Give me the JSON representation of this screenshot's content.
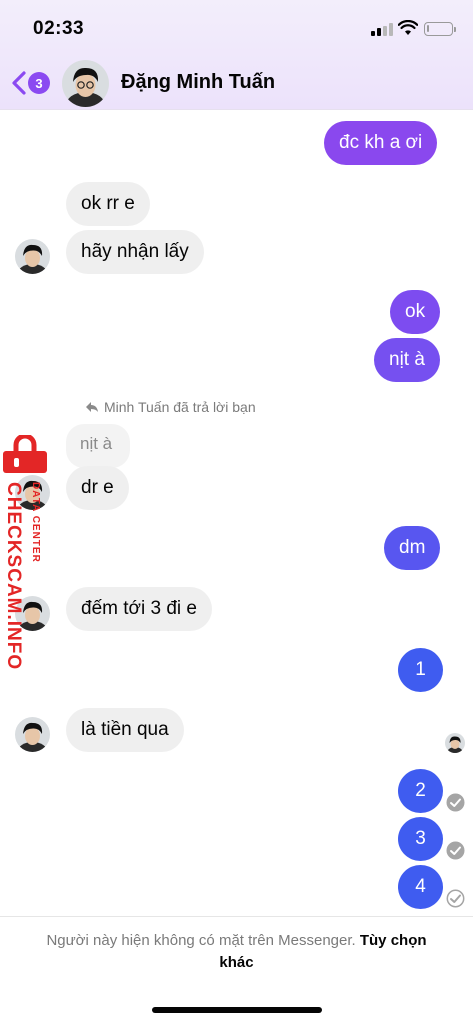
{
  "status_bar": {
    "time": "02:33"
  },
  "header": {
    "back_badge": "3",
    "contact_name": "Đặng Minh Tuấn",
    "icons": [
      "chevron-left-icon",
      "avatar"
    ]
  },
  "colors": {
    "accent": "#8b4af1",
    "out_purple": "#7a4ef0",
    "out_blue": "#3f5cf0",
    "in_bubble": "#efefef"
  },
  "messages": [
    {
      "id": "m1",
      "side": "out",
      "text": "đc kh a ơi"
    },
    {
      "id": "m2",
      "side": "in",
      "text": "ok rr e"
    },
    {
      "id": "m3",
      "side": "in",
      "text": "hãy nhận lấy"
    },
    {
      "id": "m4",
      "side": "out",
      "text": "ok"
    },
    {
      "id": "m5",
      "side": "out",
      "text": "nịt à"
    },
    {
      "id": "m6",
      "side": "in",
      "text": "dr e",
      "reply_note": "Minh Tuấn đã trả lời bạn",
      "quoted": "nịt à"
    },
    {
      "id": "m7",
      "side": "out",
      "text": "dm"
    },
    {
      "id": "m8",
      "side": "in",
      "text": "đếm tới 3 đi e"
    },
    {
      "id": "m9",
      "side": "out",
      "text": "1"
    },
    {
      "id": "m10",
      "side": "in",
      "text": "là tiền qua"
    },
    {
      "id": "m11",
      "side": "out",
      "text": "2"
    },
    {
      "id": "m12",
      "side": "out",
      "text": "3"
    },
    {
      "id": "m13",
      "side": "out",
      "text": "4"
    }
  ],
  "watermark": {
    "main": "CHECKSCAM.INFO",
    "sub": "DATA CENTER"
  },
  "footer": {
    "text": "Người này hiện không có mặt trên Messenger.",
    "link": "Tùy chọn khác"
  }
}
